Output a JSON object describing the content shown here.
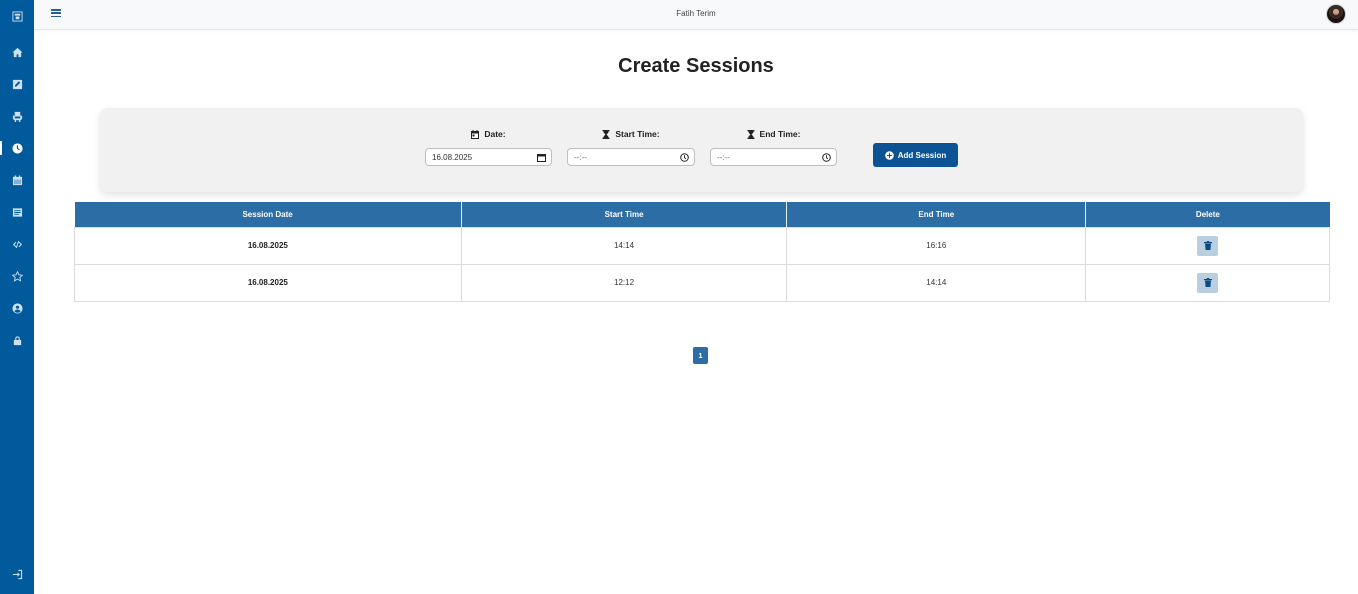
{
  "header": {
    "user_name": "Fatih Terim"
  },
  "sidebar": {
    "items": [
      {
        "icon": "logo-icon"
      },
      {
        "icon": "home-icon"
      },
      {
        "icon": "edit-icon"
      },
      {
        "icon": "seat-icon"
      },
      {
        "icon": "clock-icon",
        "active": true
      },
      {
        "icon": "calendar-icon"
      },
      {
        "icon": "list-icon"
      },
      {
        "icon": "code-icon"
      },
      {
        "icon": "star-icon"
      },
      {
        "icon": "user-circle-icon"
      },
      {
        "icon": "lock-icon"
      },
      {
        "icon": "sign-in-icon"
      }
    ]
  },
  "page": {
    "title": "Create Sessions"
  },
  "form": {
    "date_label": "Date:",
    "date_value": "16.08.2025",
    "start_label": "Start Time:",
    "start_value": "--:--",
    "end_label": "End Time:",
    "end_value": "--:--",
    "add_button": "Add Session"
  },
  "table": {
    "headers": [
      "Session Date",
      "Start Time",
      "End Time",
      "Delete"
    ],
    "rows": [
      {
        "date": "16.08.2025",
        "start": "14:14",
        "end": "16:16"
      },
      {
        "date": "16.08.2025",
        "start": "12:12",
        "end": "14:14"
      }
    ]
  },
  "pagination": {
    "current": "1"
  },
  "colors": {
    "sidebar": "#005a9c",
    "table_header": "#2b6da4",
    "button": "#0b5394"
  }
}
